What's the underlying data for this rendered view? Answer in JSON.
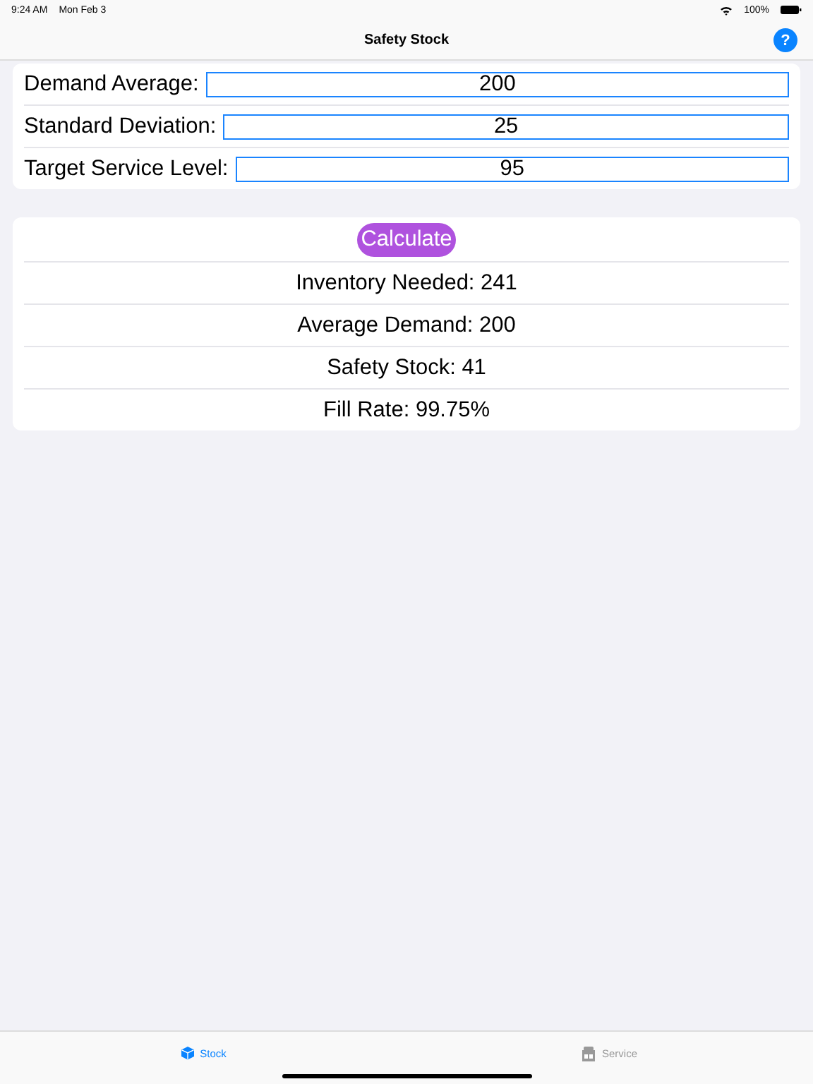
{
  "status_bar": {
    "time": "9:24 AM",
    "date": "Mon Feb 3",
    "battery": "100%"
  },
  "nav_bar": {
    "title": "Safety Stock",
    "help": "?"
  },
  "inputs": [
    {
      "label": "Demand Average:",
      "value": "200"
    },
    {
      "label": "Standard Deviation:",
      "value": "25"
    },
    {
      "label": "Target Service Level:",
      "value": "95"
    }
  ],
  "calculate_button": "Calculate",
  "results": [
    "Inventory Needed: 241",
    "Average Demand: 200",
    "Safety Stock: 41",
    "Fill Rate: 99.75%"
  ],
  "tab_bar": [
    {
      "label": "Stock",
      "kind": "box",
      "selected": true
    },
    {
      "label": "Service",
      "kind": "store",
      "selected": false
    }
  ]
}
